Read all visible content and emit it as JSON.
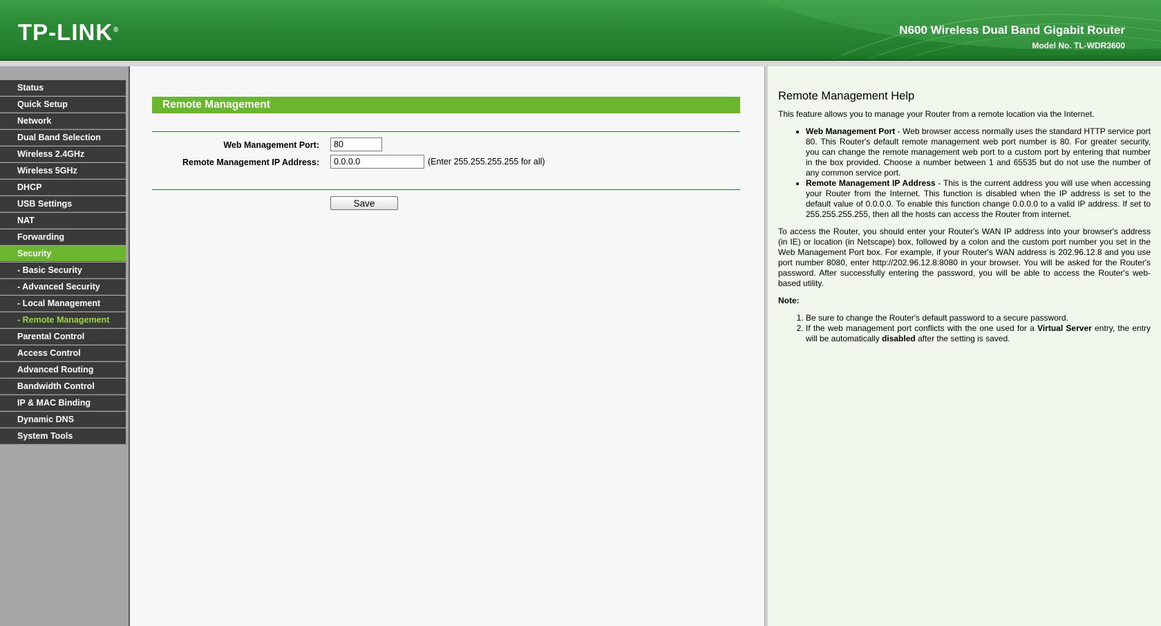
{
  "header": {
    "logo": "TP-LINK",
    "logo_mark": "®",
    "product_name": "N600 Wireless Dual Band Gigabit Router",
    "model_no": "Model No. TL-WDR3600"
  },
  "sidebar": {
    "items": [
      {
        "label": "Status"
      },
      {
        "label": "Quick Setup"
      },
      {
        "label": "Network"
      },
      {
        "label": "Dual Band Selection"
      },
      {
        "label": "Wireless 2.4GHz"
      },
      {
        "label": "Wireless 5GHz"
      },
      {
        "label": "DHCP"
      },
      {
        "label": "USB Settings"
      },
      {
        "label": "NAT"
      },
      {
        "label": "Forwarding"
      },
      {
        "label": "Security"
      },
      {
        "label": "- Basic Security"
      },
      {
        "label": "- Advanced Security"
      },
      {
        "label": "- Local Management"
      },
      {
        "label": "- Remote Management"
      },
      {
        "label": "Parental Control"
      },
      {
        "label": "Access Control"
      },
      {
        "label": "Advanced Routing"
      },
      {
        "label": "Bandwidth Control"
      },
      {
        "label": "IP & MAC Binding"
      },
      {
        "label": "Dynamic DNS"
      },
      {
        "label": "System Tools"
      }
    ]
  },
  "main": {
    "title": "Remote Management",
    "port_label": "Web Management Port:",
    "port_value": "80",
    "ip_label": "Remote Management IP Address:",
    "ip_value": "0.0.0.0",
    "ip_hint": "(Enter 255.255.255.255 for all)",
    "save_label": "Save"
  },
  "help": {
    "title": "Remote Management Help",
    "intro": "This feature allows you to manage your Router from a remote location via the Internet.",
    "item1_term": "Web Management Port",
    "item1_text": " - Web browser access normally uses the standard HTTP service port 80. This Router's default remote management web port number is 80. For greater security, you can change the remote management web port to a custom port by entering that number in the box provided. Choose a number between 1 and 65535 but do not use the number of any common service port.",
    "item2_term": "Remote Management IP Address",
    "item2_text": " - This is the current address you will use when accessing your Router from the Internet. This function is disabled when the IP address is set to the default value of 0.0.0.0. To enable this function change 0.0.0.0 to a valid IP address. If set to 255.255.255.255, then all the hosts can access the Router from internet.",
    "para2": "To access the Router, you should enter your Router's WAN IP address into your browser's address (in IE) or location (in Netscape) box, followed by a colon and the custom port number you set in the Web Management Port box. For example, if your Router's WAN address is 202.96.12.8 and you use port number 8080, enter http://202.96.12.8:8080 in your browser. You will be asked for the Router's password. After successfully entering the password, you will be able to access the Router's web-based utility.",
    "note_label": "Note:",
    "note1": "Be sure to change the Router's default password to a secure password.",
    "note2_a": "If the web management port conflicts with the one used for a ",
    "note2_b": "Virtual Server",
    "note2_c": " entry, the entry will be automatically ",
    "note2_d": "disabled",
    "note2_e": " after the setting is saved."
  },
  "colors": {
    "header_green": "#2b8a35",
    "accent_green": "#6ab72e",
    "menu_dark": "#3a3a3a",
    "sidebar_gray": "#a5a5a5"
  }
}
